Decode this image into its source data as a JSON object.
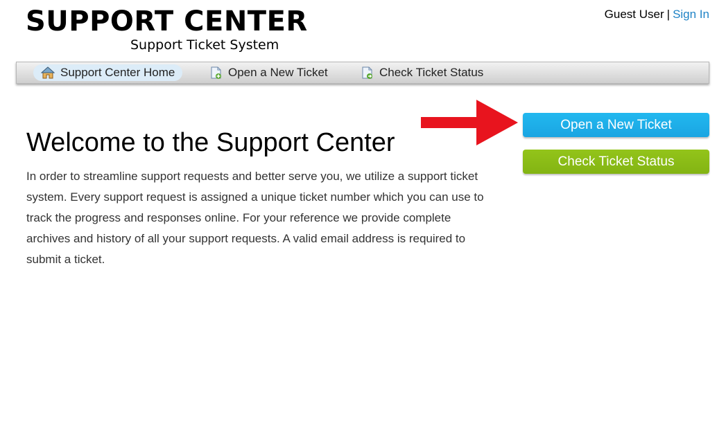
{
  "header": {
    "logo_title": "SUPPORT CENTER",
    "logo_subtitle": "Support Ticket System",
    "guest_label": "Guest User",
    "separator": "|",
    "sign_in": "Sign In"
  },
  "nav": {
    "items": [
      {
        "label": "Support Center Home",
        "icon": "home-icon",
        "active": true
      },
      {
        "label": "Open a New Ticket",
        "icon": "new-ticket-icon",
        "active": false
      },
      {
        "label": "Check Ticket Status",
        "icon": "ticket-status-icon",
        "active": false
      }
    ]
  },
  "main": {
    "title": "Welcome to the Support Center",
    "intro": "In order to streamline support requests and better serve you, we utilize a support ticket system. Every support request is assigned a unique ticket number which you can use to track the progress and responses online. For your reference we provide complete archives and history of all your support requests. A valid email address is required to submit a ticket."
  },
  "actions": {
    "open_ticket": "Open a New Ticket",
    "check_status": "Check Ticket Status"
  },
  "colors": {
    "link": "#1f83c6",
    "open_button": "#1aa5e2",
    "status_button": "#83b413",
    "annotation_arrow": "#e8141e"
  }
}
